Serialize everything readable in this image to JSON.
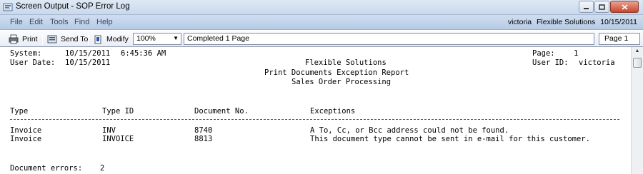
{
  "window": {
    "title": "Screen Output - SOP Error Log"
  },
  "menu": {
    "items": [
      "File",
      "Edit",
      "Tools",
      "Find",
      "Help"
    ],
    "user": "victoria",
    "company": "Flexible Solutions",
    "date": "10/15/2011"
  },
  "toolbar": {
    "print_label": "Print",
    "send_to_label": "Send To",
    "modify_label": "Modify",
    "zoom_value": "100%",
    "status_text": "Completed 1 Page",
    "page_indicator": "Page 1"
  },
  "report": {
    "system_label": "System:",
    "system_date": "10/15/2011",
    "system_time": "6:45:36 AM",
    "user_date_label": "User Date:",
    "user_date": "10/15/2011",
    "page_label": "Page:",
    "page_number": "1",
    "user_id_label": "User ID:",
    "user_id": "victoria",
    "company": "Flexible Solutions",
    "report_title": "Print Documents Exception Report",
    "report_subtitle": "Sales Order Processing",
    "columns": [
      "Type",
      "Type ID",
      "Document No.",
      "Exceptions"
    ],
    "rows": [
      {
        "type": "Invoice",
        "type_id": "INV",
        "document_no": "8740",
        "exception": "A To, Cc, or Bcc address could not be found."
      },
      {
        "type": "Invoice",
        "type_id": "INVOICE",
        "document_no": "8813",
        "exception": "This document type cannot be sent in e-mail for this customer."
      }
    ],
    "errors_label": "Document errors:",
    "errors_count": "2"
  }
}
